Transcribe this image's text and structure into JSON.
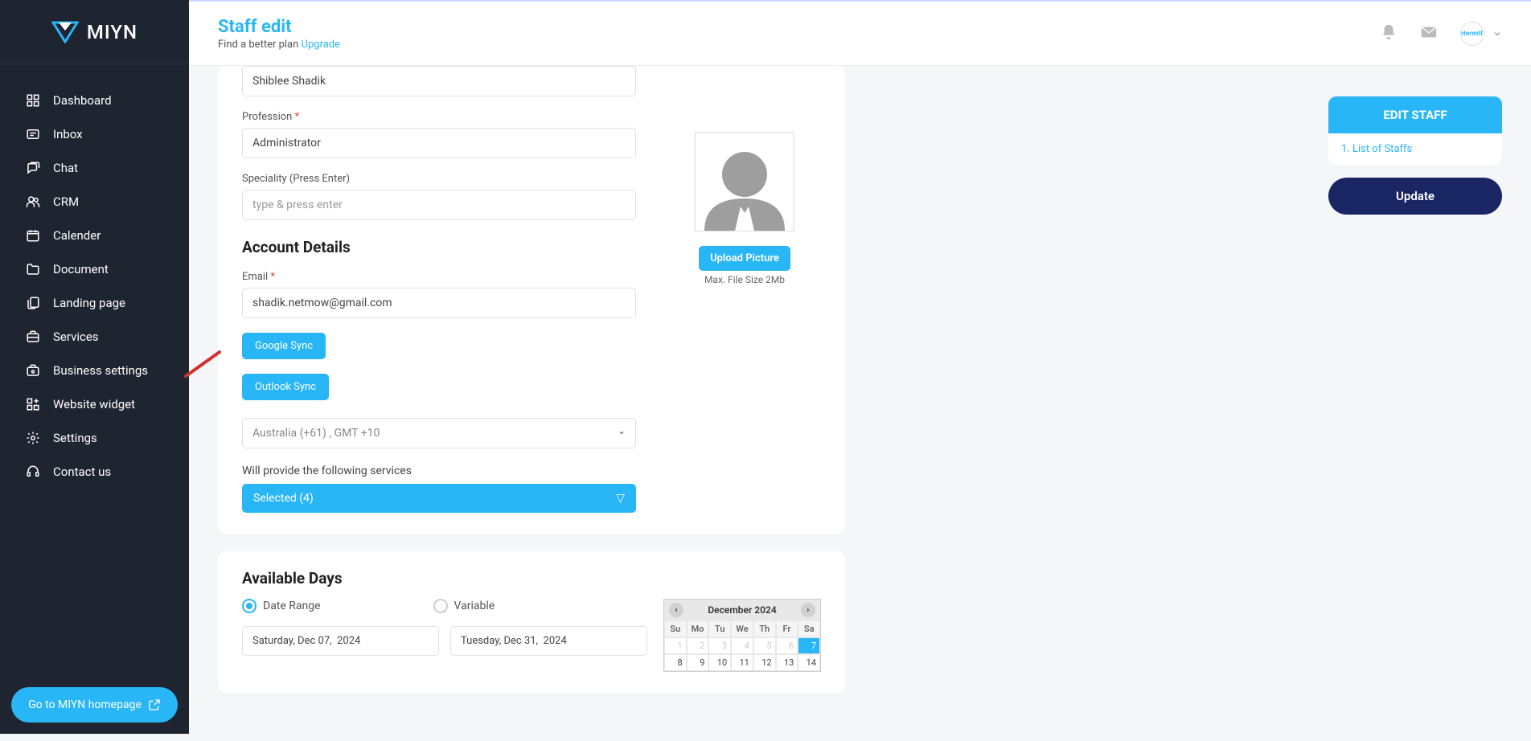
{
  "brand": "MIYN",
  "sidebar": {
    "items": [
      {
        "label": "Dashboard",
        "icon": "grid-icon"
      },
      {
        "label": "Inbox",
        "icon": "message-icon"
      },
      {
        "label": "Chat",
        "icon": "chat-icon"
      },
      {
        "label": "CRM",
        "icon": "users-icon"
      },
      {
        "label": "Calender",
        "icon": "calendar-icon"
      },
      {
        "label": "Document",
        "icon": "folder-icon"
      },
      {
        "label": "Landing page",
        "icon": "copy-icon"
      },
      {
        "label": "Services",
        "icon": "briefcase-icon"
      },
      {
        "label": "Business settings",
        "icon": "sliders-icon"
      },
      {
        "label": "Website widget",
        "icon": "widget-icon"
      },
      {
        "label": "Settings",
        "icon": "gear-icon"
      },
      {
        "label": "Contact us",
        "icon": "headset-icon"
      }
    ],
    "homepage_btn": "Go to MIYN homepage"
  },
  "header": {
    "title": "Staff edit",
    "subtitle_pre": "Find a better plan ",
    "subtitle_link": "Upgrade",
    "avatar_label": "InterestIT"
  },
  "form": {
    "name_value": "Shiblee Shadik",
    "profession_label": "Profession",
    "profession_value": "Administrator",
    "speciality_label": "Speciality (Press Enter)",
    "speciality_placeholder": "type & press enter",
    "account_heading": "Account Details",
    "email_label": "Email",
    "email_value": "shadik.netmow@gmail.com",
    "google_sync": "Google Sync",
    "outlook_sync": "Outlook Sync",
    "tz_value": "Australia (+61) , GMT +10",
    "services_label": "Will provide the following services",
    "services_selected": "Selected (4)"
  },
  "picture": {
    "upload": "Upload Picture",
    "hint": "Max. File Size 2Mb"
  },
  "avail": {
    "heading": "Available Days",
    "opt_range": "Date Range",
    "opt_variable": "Variable",
    "date_from": "Saturday, Dec 07,  2024",
    "date_to": "Tuesday, Dec 31,  2024"
  },
  "calendar": {
    "month": "December 2024",
    "dow": [
      "Su",
      "Mo",
      "Tu",
      "We",
      "Th",
      "Fr",
      "Sa"
    ],
    "row1": [
      1,
      2,
      3,
      4,
      5,
      6,
      7
    ],
    "row2": [
      8,
      9,
      10,
      11,
      12,
      13,
      14
    ],
    "selected": 7
  },
  "side": {
    "heading": "EDIT STAFF",
    "link1": "1. List of Staffs",
    "update": "Update"
  }
}
